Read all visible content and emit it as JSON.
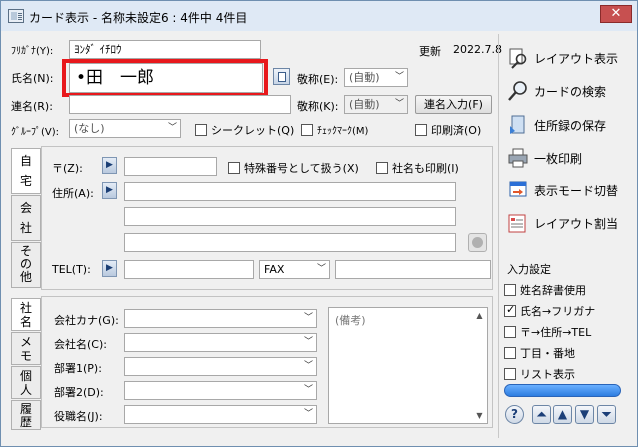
{
  "window": {
    "title": "カード表示 - 名称未設定6 : 4件中 4件目",
    "close_label": "✕"
  },
  "header": {
    "furigana_label": "ﾌﾘｶﾞﾅ(Y):",
    "furigana_value": "ﾖﾝﾀﾞ ｲﾁﾛｳ",
    "updated_label": "更新",
    "updated_date": "2022.7.8",
    "name_label": "氏名(N):",
    "name_value": "•田　一郎",
    "honorific_label": "敬称(E):",
    "honorific_value": "(自動)",
    "joint_label": "連名(R):",
    "honorific2_label": "敬称(K):",
    "honorific2_value": "(自動)",
    "joint_input_button": "連名入力(F)",
    "group_label": "ｸﾞﾙｰﾌﾟ(V):",
    "group_value": "(なし)",
    "secret_label": "シークレット(Q)",
    "checkmark_label": "ﾁｪｯｸﾏｰｸ(M)",
    "printed_label": "印刷済(O)"
  },
  "address_tabs": [
    "自宅",
    "会社",
    "その他"
  ],
  "address": {
    "zip_label": "〒(Z):",
    "special_label": "特殊番号として扱う(X)",
    "company_print_label": "社名も印刷(I)",
    "address_label": "住所(A):",
    "tel_label": "TEL(T):",
    "fax_value": "FAX"
  },
  "bottom_tabs": [
    "社名",
    "メモ",
    "個人",
    "履歴"
  ],
  "company": {
    "fields": [
      {
        "label": "会社カナ(G):"
      },
      {
        "label": "会社名(C):"
      },
      {
        "label": "部署1(P):"
      },
      {
        "label": "部署2(D):"
      },
      {
        "label": "役職名(J):"
      }
    ],
    "memo_placeholder": "(備考)"
  },
  "sidebar": {
    "buttons": [
      {
        "label": "レイアウト表示",
        "icon": "magnifier-icon"
      },
      {
        "label": "カードの検索",
        "icon": "search-icon"
      },
      {
        "label": "住所録の保存",
        "icon": "save-icon"
      },
      {
        "label": "一枚印刷",
        "icon": "printer-icon"
      },
      {
        "label": "表示モード切替",
        "icon": "view-mode-icon"
      },
      {
        "label": "レイアウト割当",
        "icon": "layout-assign-icon"
      }
    ],
    "settings_title": "入力設定",
    "settings": [
      {
        "label": "姓名辞書使用",
        "checked": false
      },
      {
        "label": "氏名→フリガナ",
        "checked": true
      },
      {
        "label": "〒→住所→TEL",
        "checked": false
      },
      {
        "label": "丁目・番地",
        "checked": false
      },
      {
        "label": "リスト表示",
        "checked": false
      }
    ],
    "nav": [
      "?",
      "⏶",
      "▲",
      "▼",
      "⏷"
    ]
  }
}
